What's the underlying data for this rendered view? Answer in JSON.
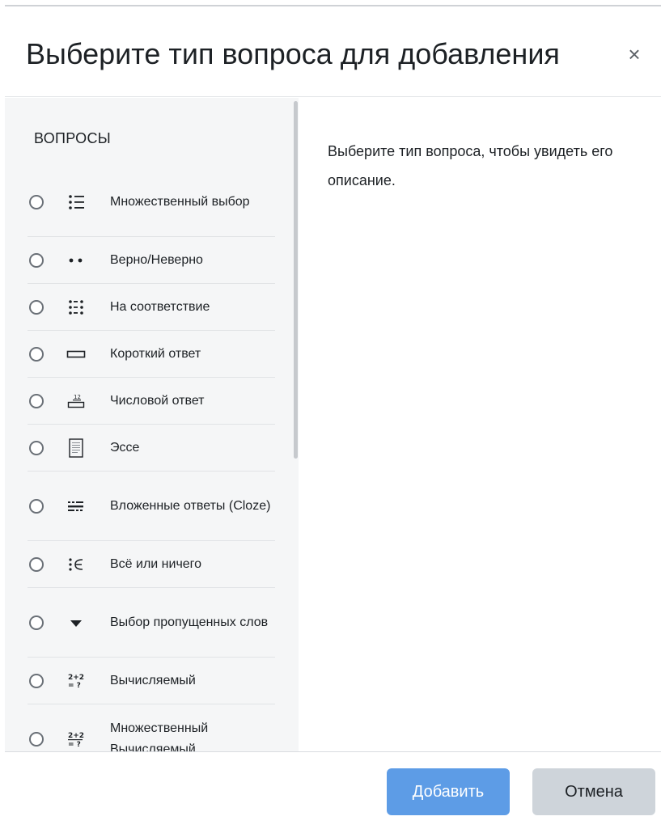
{
  "dialog": {
    "title": "Выберите тип вопроса для добавления",
    "close_glyph": "×"
  },
  "section": {
    "label": "ВОПРОСЫ"
  },
  "questions": [
    {
      "label": "Множественный выбор",
      "icon": "multichoice-icon",
      "selected": false
    },
    {
      "label": "Верно/Неверно",
      "icon": "truefalse-icon",
      "selected": false
    },
    {
      "label": "На соответствие",
      "icon": "match-icon",
      "selected": false
    },
    {
      "label": "Короткий ответ",
      "icon": "shortanswer-icon",
      "selected": false
    },
    {
      "label": "Числовой ответ",
      "icon": "numerical-icon",
      "selected": false
    },
    {
      "label": "Эссе",
      "icon": "essay-icon",
      "selected": false
    },
    {
      "label": "Вложенные ответы (Cloze)",
      "icon": "cloze-icon",
      "selected": false
    },
    {
      "label": "Всё или ничего",
      "icon": "allornothing-icon",
      "selected": false
    },
    {
      "label": "Выбор пропущенных слов",
      "icon": "gapselect-icon",
      "selected": false
    },
    {
      "label": "Вычисляемый",
      "icon": "calculated-icon",
      "selected": false
    },
    {
      "label": "Множественный Вычисляемый",
      "icon": "calculatedmulti-icon",
      "selected": false
    }
  ],
  "description": {
    "text": "Выберите тип вопроса, чтобы увидеть его описание."
  },
  "footer": {
    "add_label": "Добавить",
    "cancel_label": "Отмена"
  },
  "colors": {
    "primary": "#5d9ce6",
    "secondary": "#ced4da",
    "panel": "#f5f6f7"
  }
}
